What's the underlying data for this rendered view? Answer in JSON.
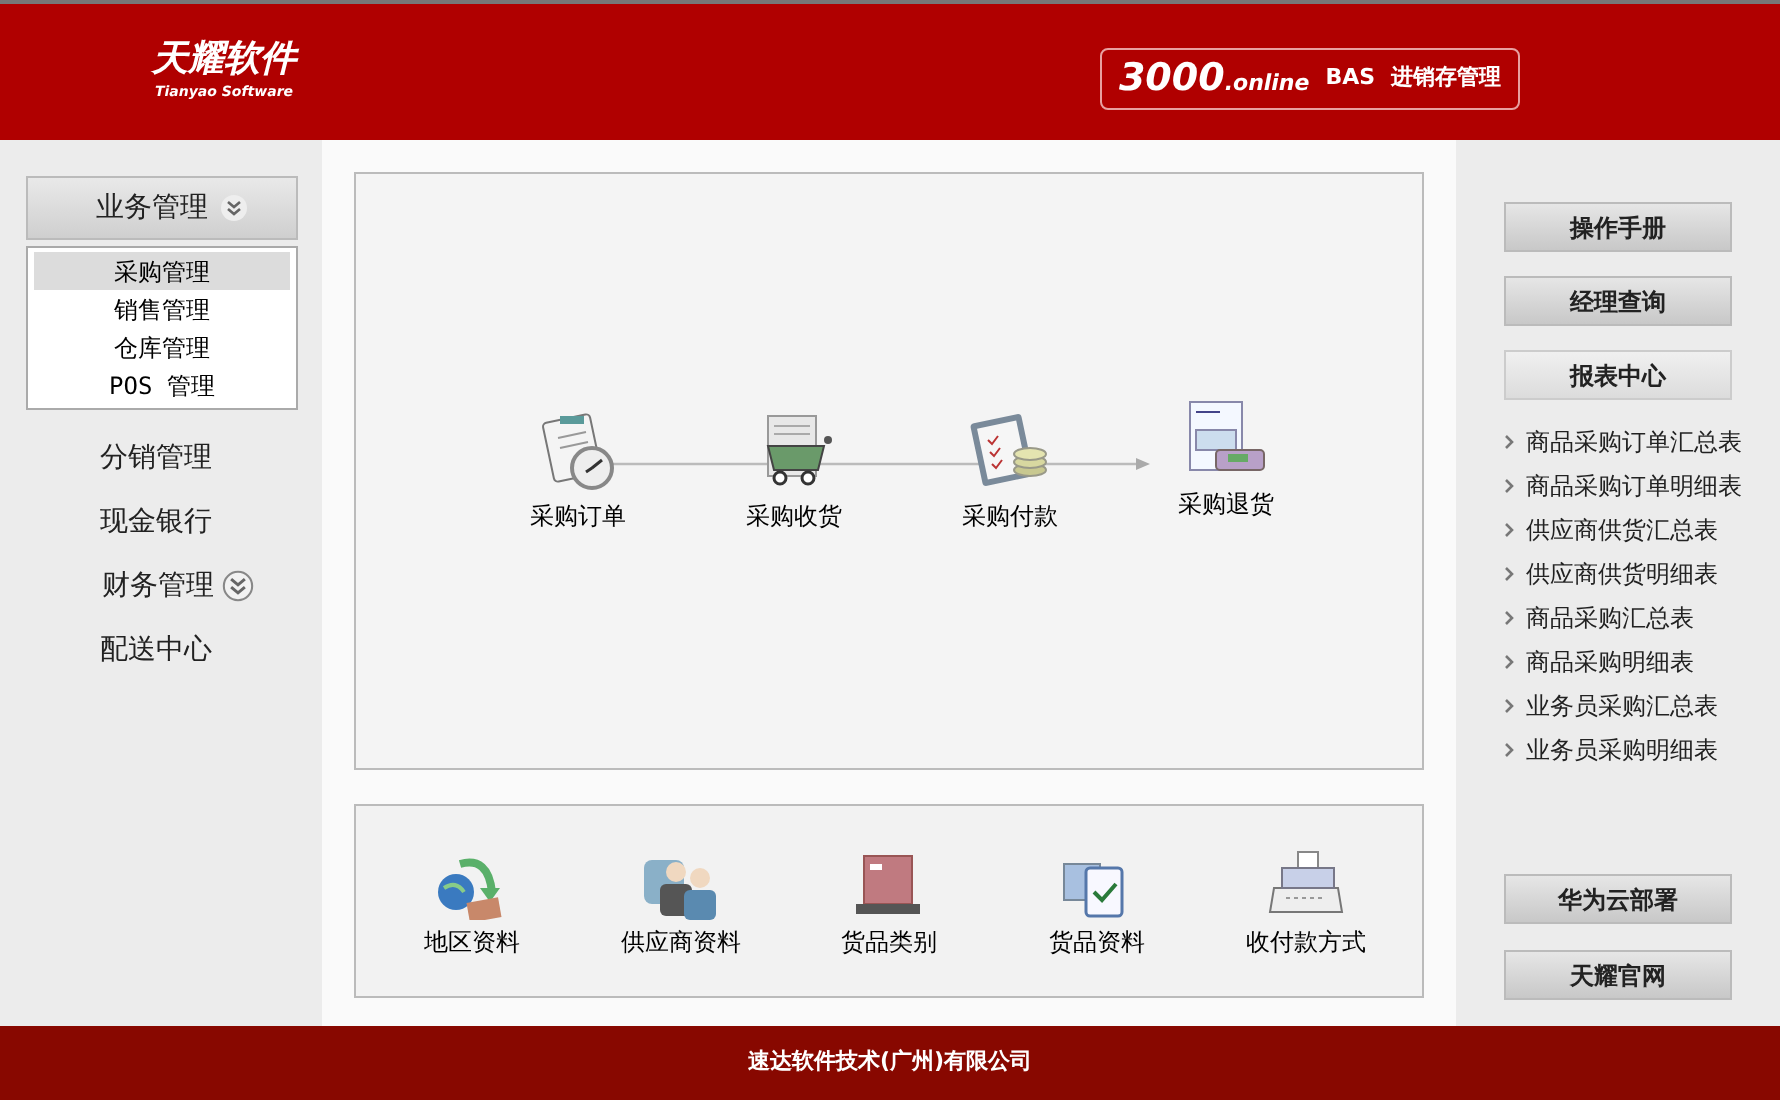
{
  "header": {
    "logo": {
      "title": "天耀软件",
      "subtitle": "Tianyao Software"
    },
    "product_badge": {
      "number": "3000",
      "suffix": ".online",
      "edition": "BAS",
      "name": "进销存管理"
    }
  },
  "sidebar": {
    "items": [
      {
        "label": "业务管理",
        "kind": "group",
        "expanded": true,
        "children": [
          {
            "label": "采购管理",
            "selected": true
          },
          {
            "label": "销售管理",
            "selected": false
          },
          {
            "label": "仓库管理",
            "selected": false
          },
          {
            "label": "POS 管理",
            "selected": false
          }
        ]
      },
      {
        "label": "分销管理",
        "kind": "link"
      },
      {
        "label": "现金银行",
        "kind": "link"
      },
      {
        "label": "财务管理",
        "kind": "group",
        "expanded": false
      },
      {
        "label": "配送中心",
        "kind": "link"
      }
    ]
  },
  "flow": {
    "steps": [
      {
        "label": "采购订单"
      },
      {
        "label": "采购收货"
      },
      {
        "label": "采购付款"
      },
      {
        "label": "采购退货"
      }
    ]
  },
  "basics": {
    "items": [
      {
        "label": "地区资料"
      },
      {
        "label": "供应商资料"
      },
      {
        "label": "货品类别"
      },
      {
        "label": "货品资料"
      },
      {
        "label": "收付款方式"
      }
    ]
  },
  "right_panel": {
    "buttons": [
      "操作手册",
      "经理查询"
    ],
    "report_header": "报表中心",
    "reports": [
      "商品采购订单汇总表",
      "商品采购订单明细表",
      "供应商供货汇总表",
      "供应商供货明细表",
      "商品采购汇总表",
      "商品采购明细表",
      "业务员采购汇总表",
      "业务员采购明细表"
    ],
    "bottom_buttons": [
      "华为云部署",
      "天耀官网"
    ]
  },
  "footer": "速达软件技术(广州)有限公司"
}
